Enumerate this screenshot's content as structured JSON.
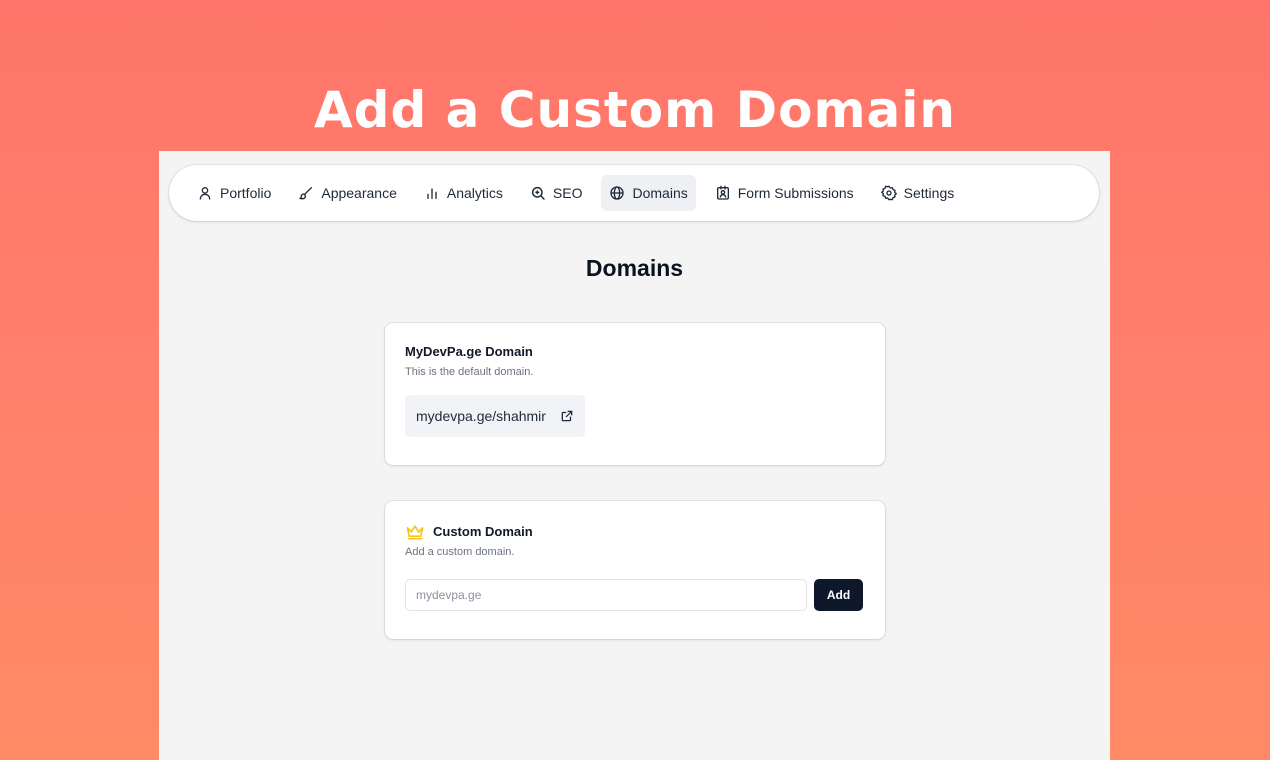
{
  "headline": "Add a Custom Domain",
  "nav": {
    "items": [
      {
        "label": "Portfolio",
        "icon": "user-icon"
      },
      {
        "label": "Appearance",
        "icon": "brush-icon"
      },
      {
        "label": "Analytics",
        "icon": "bar-chart-icon"
      },
      {
        "label": "SEO",
        "icon": "search-icon"
      },
      {
        "label": "Domains",
        "icon": "globe-icon",
        "active": true
      },
      {
        "label": "Form Submissions",
        "icon": "contact-form-icon"
      },
      {
        "label": "Settings",
        "icon": "gear-icon"
      }
    ]
  },
  "page_title": "Domains",
  "default_domain": {
    "title": "MyDevPa.ge Domain",
    "description": "This is the default domain.",
    "url": "mydevpa.ge/shahmir",
    "icon": "external-link-icon"
  },
  "custom_domain": {
    "title": "Custom Domain",
    "description": "Add a custom domain.",
    "input_placeholder": "mydevpa.ge",
    "input_value": "",
    "button_label": "Add",
    "icon": "crown-icon"
  },
  "colors": {
    "background_gradient_top": "#ff756b",
    "background_gradient_bottom": "#ff8a66",
    "crown": "#f5c518",
    "button": "#0f172a",
    "active_tab": "#eef0f3"
  }
}
